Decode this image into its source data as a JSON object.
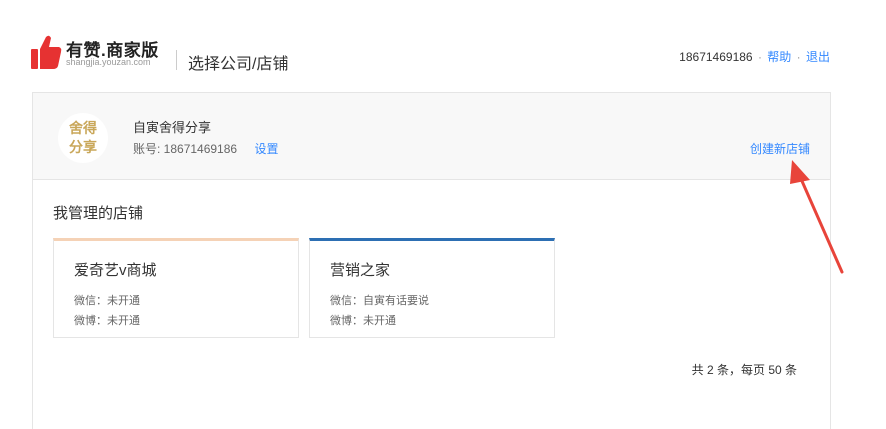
{
  "header": {
    "logo_title": "有赞.商家版",
    "logo_sub": "shangjia.youzan.com",
    "page_title": "选择公司/店铺",
    "phone": "18671469186",
    "separator": "·",
    "help": "帮助",
    "logout": "退出"
  },
  "account": {
    "avatar_text": "舍得分享",
    "name": "自寅舍得分享",
    "account_line": "账号: 18671469186",
    "settings": "设置",
    "create_store": "创建新店铺"
  },
  "stores": {
    "section_title": "我管理的店铺",
    "items": [
      {
        "name": "爱奇艺v商城",
        "wechat": "微信：未开通",
        "weibo": "微博：未开通",
        "accent": "#f5d2b6"
      },
      {
        "name": "营销之家",
        "wechat": "微信：自寅有话要说",
        "weibo": "微博：未开通",
        "accent": "#2d6fb3"
      }
    ]
  },
  "pagination": {
    "summary": "共 2 条，每页 50 条"
  },
  "colors": {
    "link": "#3388ff",
    "annotation_arrow": "#e8443a",
    "logo_red": "#e63232"
  },
  "icons": {
    "logo": "thumbs-up-icon",
    "annotation": "red-arrow-icon"
  }
}
